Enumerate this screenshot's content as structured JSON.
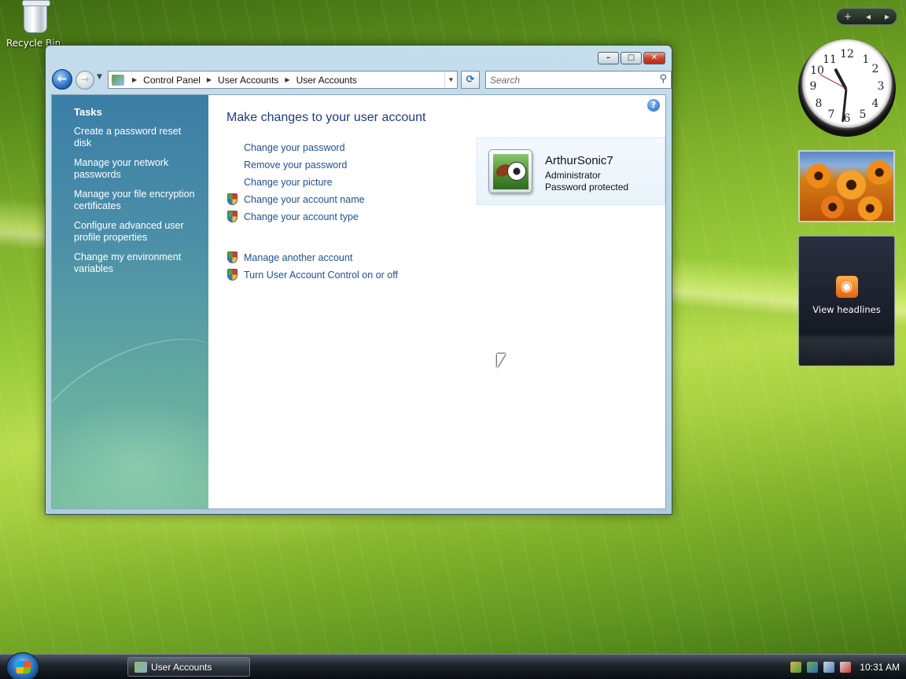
{
  "desktop": {
    "recycle_bin_label": "Recycle Bin"
  },
  "window": {
    "title": "User Accounts",
    "caption": {
      "minimize": "▭",
      "maximize": "□",
      "close": "✕"
    },
    "address": {
      "crumbs": [
        "Control Panel",
        "User Accounts",
        "User Accounts"
      ]
    },
    "search": {
      "placeholder": "Search"
    },
    "tasks": {
      "heading": "Tasks",
      "links": [
        "Create a password reset disk",
        "Manage your network passwords",
        "Manage your file encryption certificates",
        "Configure advanced user profile properties",
        "Change my environment variables"
      ]
    },
    "main": {
      "title": "Make changes to your user account",
      "actions_primary": [
        {
          "label": "Change your password",
          "shield": false
        },
        {
          "label": "Remove your password",
          "shield": false
        },
        {
          "label": "Change your picture",
          "shield": false
        },
        {
          "label": "Change your account name",
          "shield": true
        },
        {
          "label": "Change your account type",
          "shield": true
        }
      ],
      "actions_secondary": [
        {
          "label": "Manage another account",
          "shield": true
        },
        {
          "label": "Turn User Account Control on or off",
          "shield": true
        }
      ]
    },
    "account": {
      "name": "ArthurSonic7",
      "role": "Administrator",
      "status": "Password protected"
    }
  },
  "gadgets": {
    "clock_numerals": [
      "12",
      "1",
      "2",
      "3",
      "4",
      "5",
      "6",
      "7",
      "8",
      "9",
      "10",
      "11"
    ],
    "feeds_label": "View headlines"
  },
  "taskbar": {
    "window_button_label": "User Accounts",
    "time": "10:31 AM"
  },
  "colors": {
    "link": "#1e4f9a",
    "title": "#1e3a8a",
    "taskpane": "#3b7ea6"
  }
}
